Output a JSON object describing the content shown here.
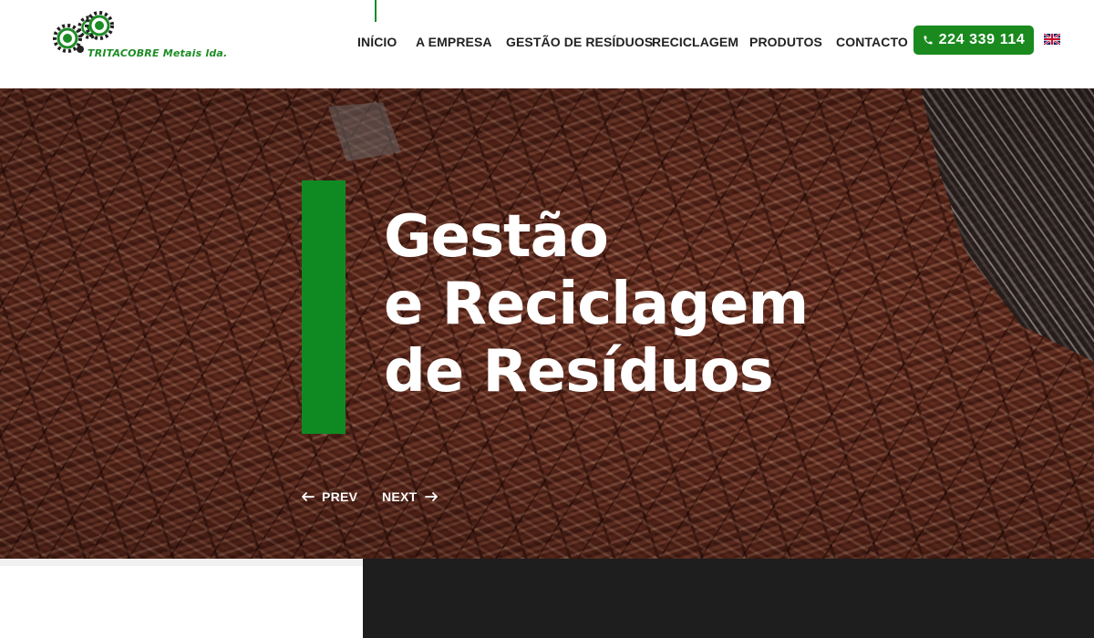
{
  "brand": {
    "logo_text": "TRITACOBRE Metais lda.",
    "primary_color": "#1a8a1f",
    "dark_color": "#1e1e1e"
  },
  "nav": {
    "items": [
      {
        "label": "INÍCIO"
      },
      {
        "label": "A EMPRESA"
      },
      {
        "label": "GESTÃO DE RESÍDUOS"
      },
      {
        "label": "RECICLAGEM"
      },
      {
        "label": "PRODUTOS"
      },
      {
        "label": "CONTACTO"
      }
    ]
  },
  "contact": {
    "phone_icon": "phone-icon",
    "phone": "224 339 114"
  },
  "language": {
    "flag_icon": "uk-flag-icon"
  },
  "hero": {
    "title_lines": [
      "Gestão",
      "e Reciclagem",
      "de Resíduos"
    ],
    "prev_label": "PREV",
    "next_label": "NEXT"
  }
}
